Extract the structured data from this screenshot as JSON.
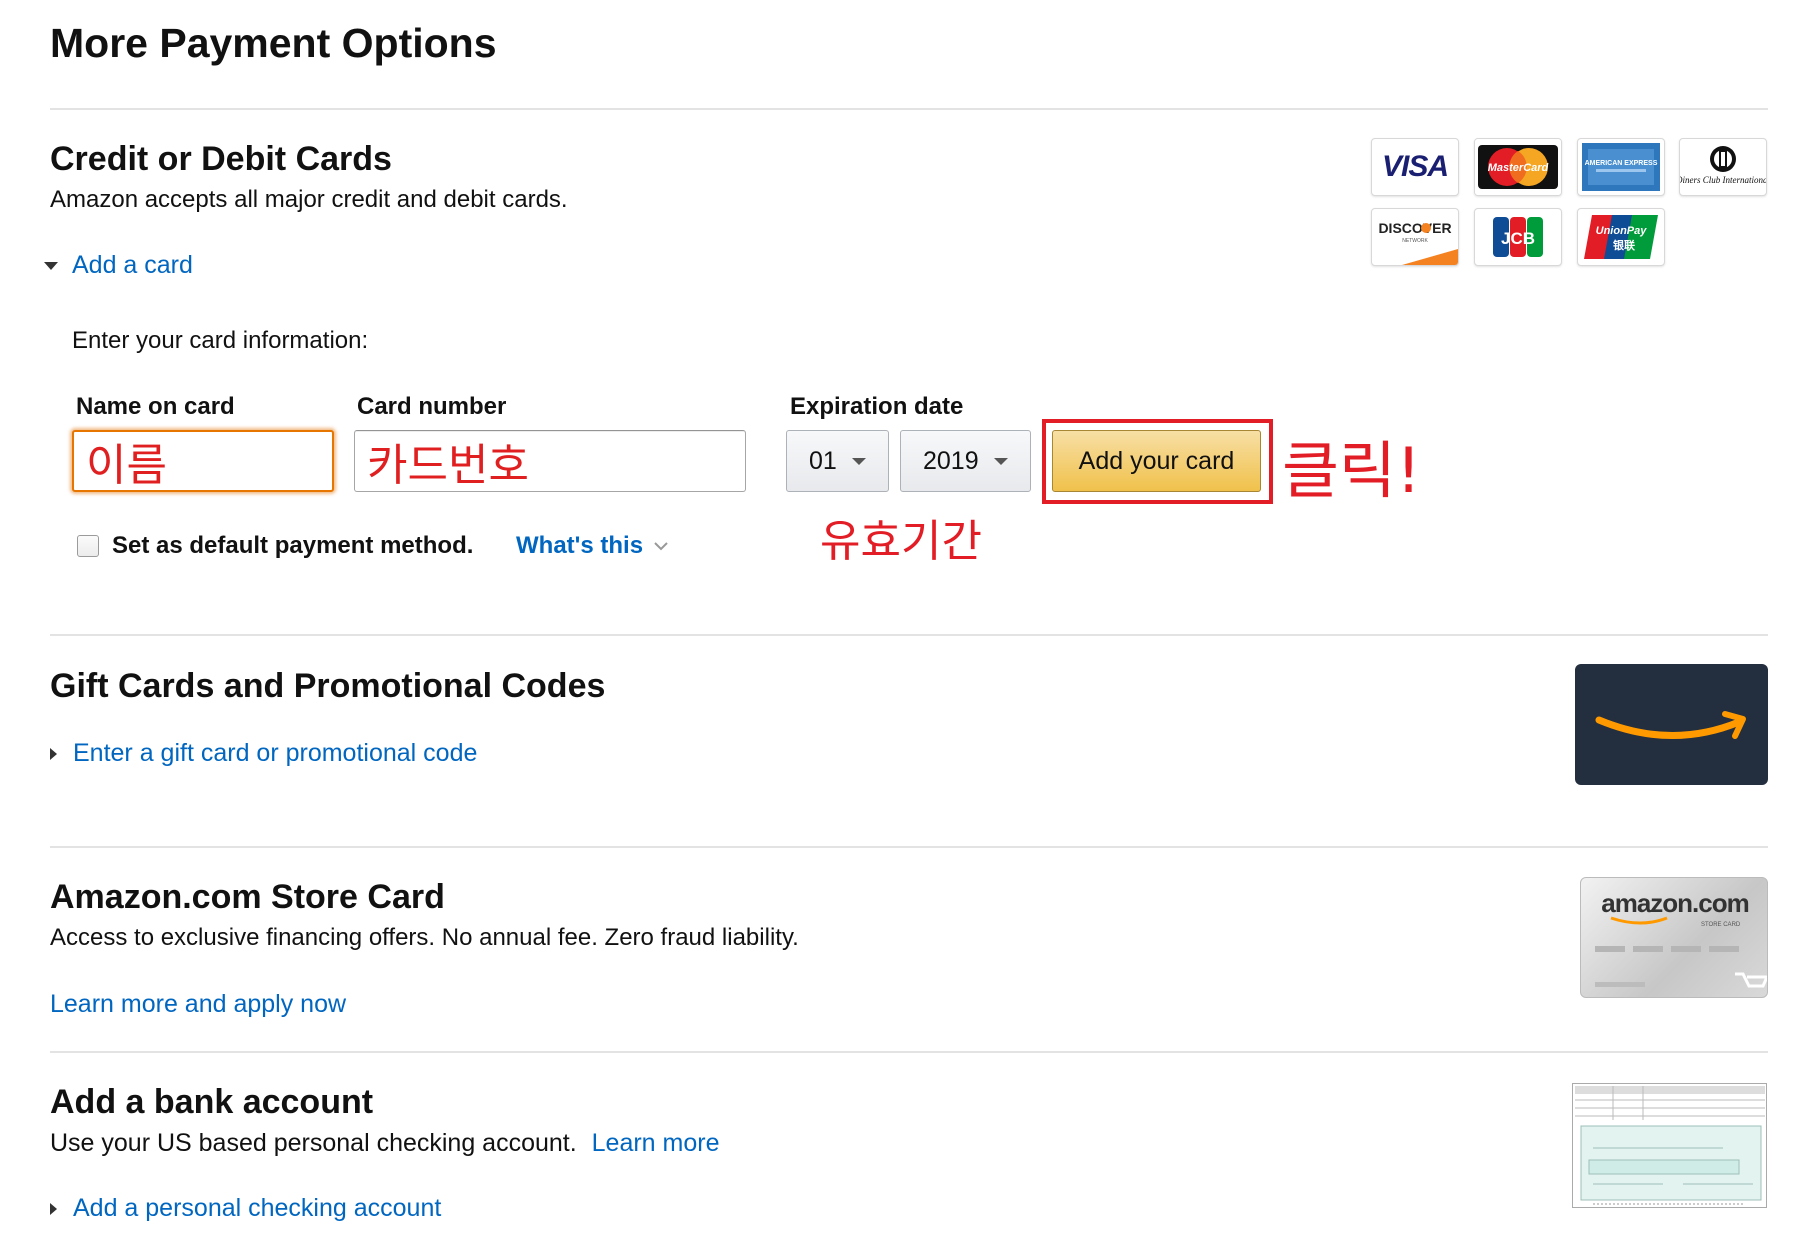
{
  "page_title": "More Payment Options",
  "credit": {
    "heading": "Credit or Debit Cards",
    "description": "Amazon accepts all major credit and debit cards.",
    "add_toggle": "Add a card",
    "enter_info": "Enter your card information:",
    "labels": {
      "name": "Name on card",
      "number": "Card number",
      "expiration": "Expiration date"
    },
    "values": {
      "name": "이름",
      "number": "카드번호",
      "month": "01",
      "year": "2019"
    },
    "add_button": "Add your card",
    "default_checkbox_label": "Set as default payment method.",
    "whats_this": "What's this",
    "logos": {
      "visa": "VISA",
      "mastercard": "MasterCard",
      "amex": "AMERICAN EXPRESS",
      "diners": "Diners Club International",
      "discover": "DISCOVER",
      "discover_sub": "NETWORK",
      "jcb": "JCB",
      "unionpay": "UnionPay",
      "unionpay_cn": "银联"
    }
  },
  "annotations": {
    "click": "클릭!",
    "expiry": "유효기간"
  },
  "gift": {
    "heading": "Gift Cards and Promotional Codes",
    "toggle": "Enter a gift card or promotional code"
  },
  "store": {
    "heading": "Amazon.com Store Card",
    "description": "Access to exclusive financing offers. No annual fee. Zero fraud liability.",
    "link": "Learn more and apply now",
    "card_brand": "amazon.com",
    "card_sub": "STORE CARD"
  },
  "bank": {
    "heading": "Add a bank account",
    "description": "Use your US based personal checking account.",
    "learn_more": "Learn more",
    "toggle": "Add a personal checking account"
  },
  "colors": {
    "link": "#0066c0",
    "annotation": "#e21d25",
    "button": "#f0c14b"
  }
}
